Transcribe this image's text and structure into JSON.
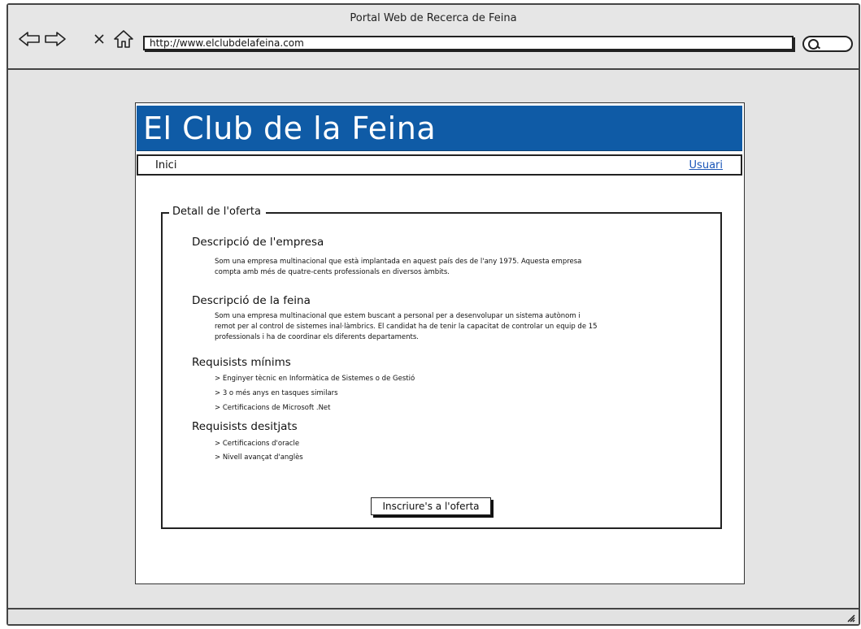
{
  "window": {
    "title": "Portal Web de Recerca de Feina"
  },
  "browser": {
    "url": "http://www.elclubdelafeina.com",
    "back_icon": "arrow-left-icon",
    "forward_icon": "arrow-right-icon",
    "stop_icon": "close-icon",
    "home_icon": "home-icon",
    "search_icon": "search-icon"
  },
  "site": {
    "title": "El Club de la Feina",
    "header_color": "#0f5ba6"
  },
  "nav": {
    "home": "Inici",
    "user": "Usuari"
  },
  "offer": {
    "legend": "Detall de l'oferta",
    "company_heading": "Descripció de l'empresa",
    "company_text_1": "Som una empresa multinacional que està implantada en aquest país des de l'any 1975. Aquesta empresa",
    "company_text_2": "compta amb més de quatre-cents professionals en diversos àmbits.",
    "job_heading": "Descripció de la feina",
    "job_text_1": "Som una empresa multinacional que estem buscant a personal per a desenvolupar un sistema autònom i",
    "job_text_2": "remot per al control de sistemes inal·làmbrics. El candidat ha de tenir la capacitat de controlar un equip de 15",
    "job_text_3": "professionals i ha de coordinar els diferents departaments.",
    "min_heading": "Requisists mínims",
    "min_items": [
      "> Enginyer tècnic en Informàtica de Sistemes o de Gestió",
      "> 3 o més anys en tasques similars",
      "> Certificacions de Microsoft .Net"
    ],
    "desired_heading": "Requisists desitjats",
    "desired_items": [
      "> Certificacions d'oracle",
      "> Nivell avançat d'anglès"
    ],
    "apply_button": "Inscriure's a l'oferta"
  }
}
